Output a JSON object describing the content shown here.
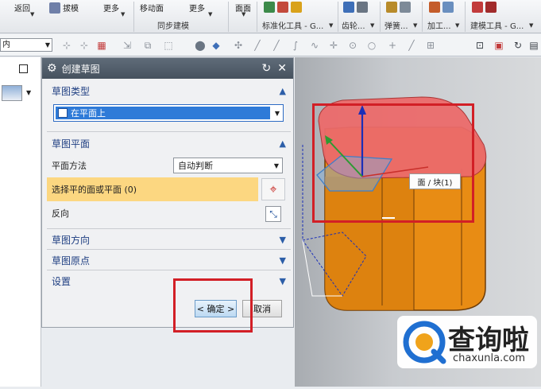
{
  "ribbon": {
    "items": [
      "返回",
      "拔模",
      "更多",
      "移动面",
      "更多",
      "面面"
    ],
    "groups": [
      {
        "label": "同步建模"
      },
      {
        "label": "标准化工具 - G..."
      },
      {
        "label": "齿轮..."
      },
      {
        "label": "弹簧..."
      },
      {
        "label": "加工..."
      },
      {
        "label": "建模工具 - G..."
      }
    ]
  },
  "toolbar": {
    "combo_value": "内"
  },
  "dialog": {
    "title": "创建草图",
    "sections": {
      "sketch_type": "草图类型",
      "sketch_plane": "草图平面",
      "sketch_orient": "草图方向",
      "sketch_origin": "草图原点",
      "settings": "设置"
    },
    "type_value": "在平面上",
    "plane_method_label": "平面方法",
    "plane_method_value": "自动判断",
    "select_label": "选择平的面或平面 (0)",
    "reverse_label": "反向",
    "ok_label": "< 确定 >",
    "cancel_label": "取消"
  },
  "viewport": {
    "tooltip": "面 / 块(1)"
  },
  "watermark": {
    "cn": "查询啦",
    "url": "chaxunla.com"
  },
  "colors": {
    "accent": "#2c5ea8",
    "highlight": "#d21f26",
    "body": "#e88c14"
  }
}
